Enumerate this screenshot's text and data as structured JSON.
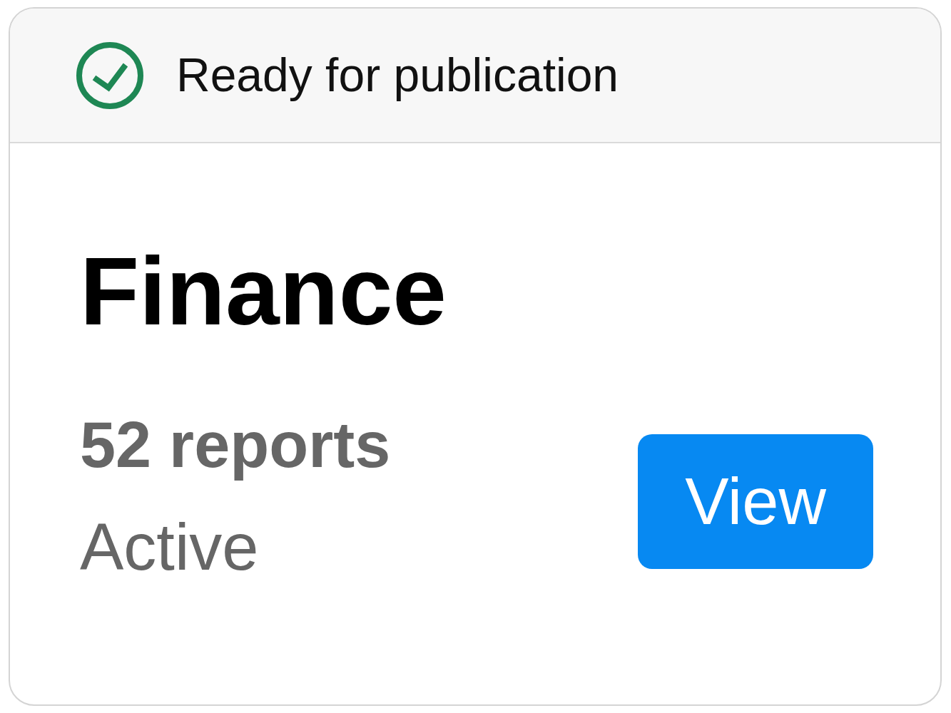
{
  "header": {
    "kind": "success",
    "label": "Ready for publication"
  },
  "title": "Finance",
  "report_count": "52 reports",
  "state": "Active",
  "button": "View"
}
